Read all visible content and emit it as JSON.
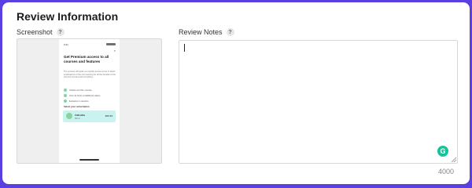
{
  "title": "Review Information",
  "screenshot": {
    "label": "Screenshot",
    "help": "?",
    "phone": {
      "status_time": "9:41",
      "close_glyph": "×",
      "heading": "Get Premium access to all courses and features",
      "description": "The process will guide you quickly access to the in-depth explanations of the core learning for all the benefits of the premium access and everything.",
      "features": [
        "Unlock over 50+ courses",
        "Over 10 hours of additional videos",
        "Exclusive in sessions"
      ],
      "select_label": "Select your subscription",
      "plan": {
        "name": "3 Months",
        "sub": "$9/mo",
        "price": "$29.99"
      }
    }
  },
  "notes": {
    "label": "Review Notes",
    "help": "?",
    "value": "",
    "grammarly_letter": "G",
    "counter": "4000"
  },
  "colors": {
    "frame": "#5b3fe0",
    "plan_bg": "#c9f3ee",
    "grammarly": "#15c39a"
  }
}
